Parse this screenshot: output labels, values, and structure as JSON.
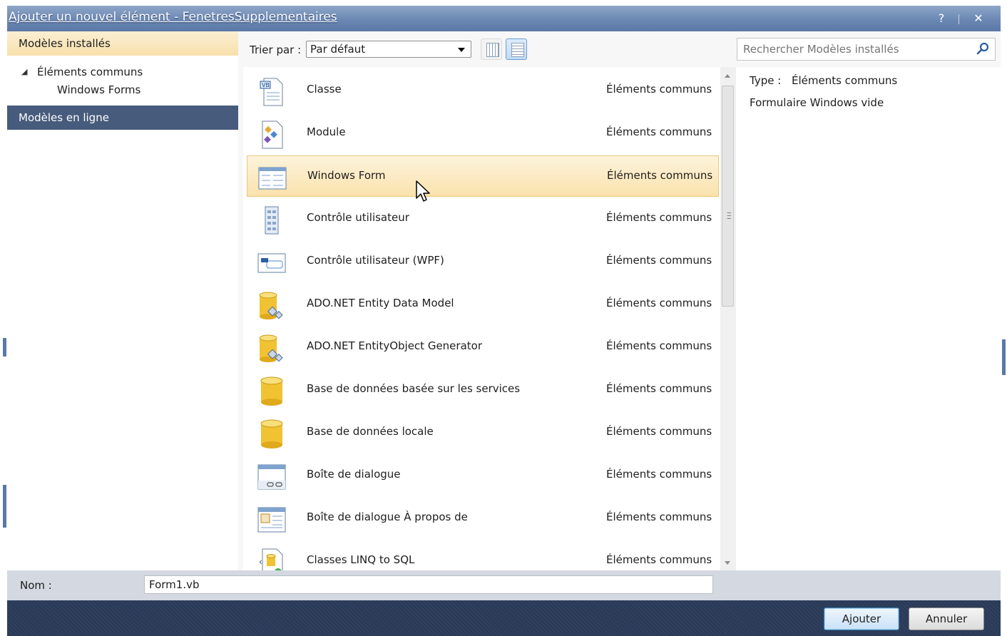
{
  "window": {
    "title": "Ajouter un nouvel élément - FenetresSupplementaires",
    "help_glyph": "?",
    "close_glyph": "✕"
  },
  "left_pane": {
    "installed_header": "Modèles installés",
    "tree": {
      "parent": "Éléments communs",
      "child": "Windows Forms"
    },
    "online_header": "Modèles en ligne"
  },
  "toolbar": {
    "sort_label": "Trier par :",
    "sort_value": "Par défaut",
    "view_small_icons": "small-icons-view",
    "view_list": "list-view"
  },
  "search": {
    "placeholder": "Rechercher Modèles installés"
  },
  "templates": [
    {
      "name": "Classe",
      "category": "Éléments communs",
      "icon": "class-icon"
    },
    {
      "name": "Module",
      "category": "Éléments communs",
      "icon": "module-icon"
    },
    {
      "name": "Windows Form",
      "category": "Éléments communs",
      "icon": "windows-form-icon",
      "selected": true
    },
    {
      "name": "Contrôle utilisateur",
      "category": "Éléments communs",
      "icon": "user-control-icon"
    },
    {
      "name": "Contrôle utilisateur (WPF)",
      "category": "Éléments communs",
      "icon": "wpf-user-control-icon"
    },
    {
      "name": "ADO.NET Entity Data Model",
      "category": "Éléments communs",
      "icon": "entity-data-model-icon"
    },
    {
      "name": "ADO.NET EntityObject Generator",
      "category": "Éléments communs",
      "icon": "entity-generator-icon"
    },
    {
      "name": "Base de données basée sur les services",
      "category": "Éléments communs",
      "icon": "database-icon"
    },
    {
      "name": "Base de données locale",
      "category": "Éléments communs",
      "icon": "database-icon"
    },
    {
      "name": "Boîte de dialogue",
      "category": "Éléments communs",
      "icon": "dialog-icon"
    },
    {
      "name": "Boîte de dialogue À propos de",
      "category": "Éléments communs",
      "icon": "about-dialog-icon"
    },
    {
      "name": "Classes LINQ to SQL",
      "category": "Éléments communs",
      "icon": "linq-icon"
    }
  ],
  "info": {
    "type_label": "Type :",
    "type_value": "Éléments communs",
    "description": "Formulaire Windows vide"
  },
  "name_field": {
    "label": "Nom :",
    "value": "Form1.vb"
  },
  "buttons": {
    "add": "Ajouter",
    "cancel": "Annuler"
  },
  "colors": {
    "titlebar": "#6b88b4",
    "selection": "#fae2ac",
    "online_header": "#475b7c",
    "bottom_bar": "#2a3a55"
  }
}
